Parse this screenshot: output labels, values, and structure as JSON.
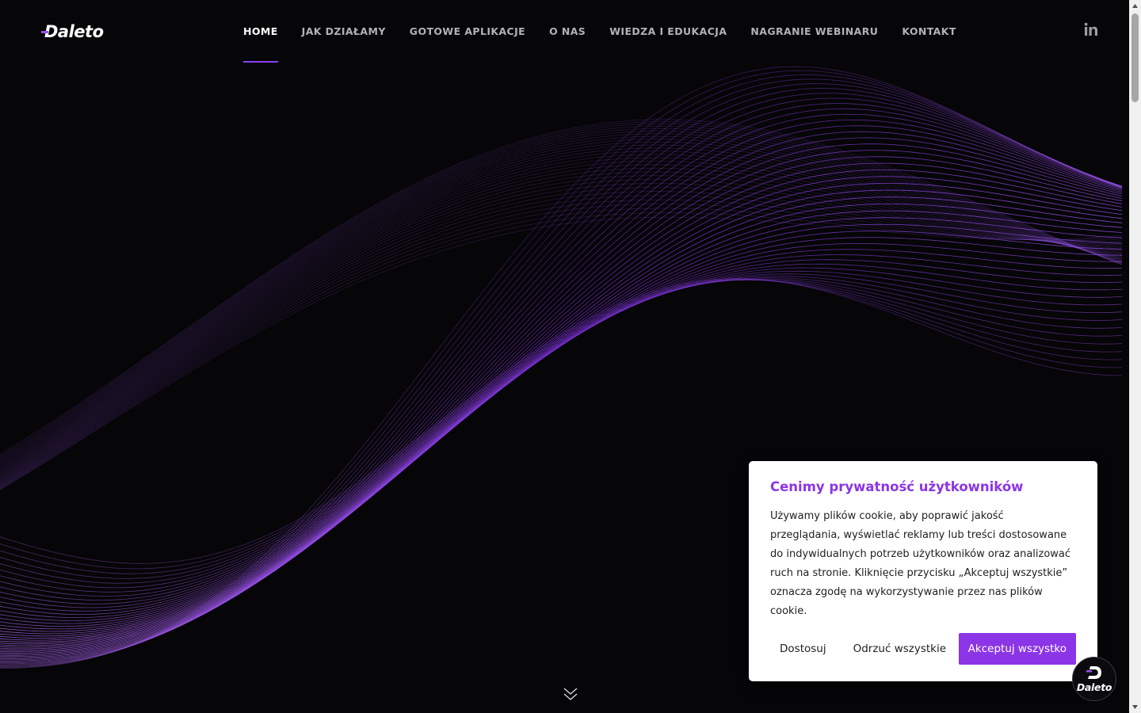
{
  "header": {
    "logo_text": "Daleto",
    "nav": [
      {
        "label": "HOME",
        "active": true
      },
      {
        "label": "JAK DZIAŁAMY",
        "active": false
      },
      {
        "label": "GOTOWE APLIKACJE",
        "active": false
      },
      {
        "label": "O NAS",
        "active": false
      },
      {
        "label": "WIEDZA I EDUKACJA",
        "active": false
      },
      {
        "label": "NAGRANIE WEBINARU",
        "active": false
      },
      {
        "label": "KONTAKT",
        "active": false
      }
    ],
    "social_icon": "linkedin-icon"
  },
  "hero": {
    "background": "#060507",
    "wave_color": "#8c35e6"
  },
  "cookie_banner": {
    "title": "Cenimy prywatność użytkowników",
    "text": "Używamy plików cookie, aby poprawić jakość przeglądania, wyświetlać reklamy lub treści dostosowane do indywidualnych potrzeb użytkowników oraz analizować ruch na stronie. Kliknięcie przycisku „Akceptuj wszystkie” oznacza zgodę na wykorzystywanie przez nas plików cookie.",
    "customize_label": "Dostosuj",
    "reject_label": "Odrzuć wszystkie",
    "accept_label": "Akceptuj wszystko",
    "accent": "#8c35e6"
  },
  "floating_badge": {
    "label": "Daleto"
  },
  "icons": {
    "scroll_hint": "chevron-down-double-icon"
  }
}
